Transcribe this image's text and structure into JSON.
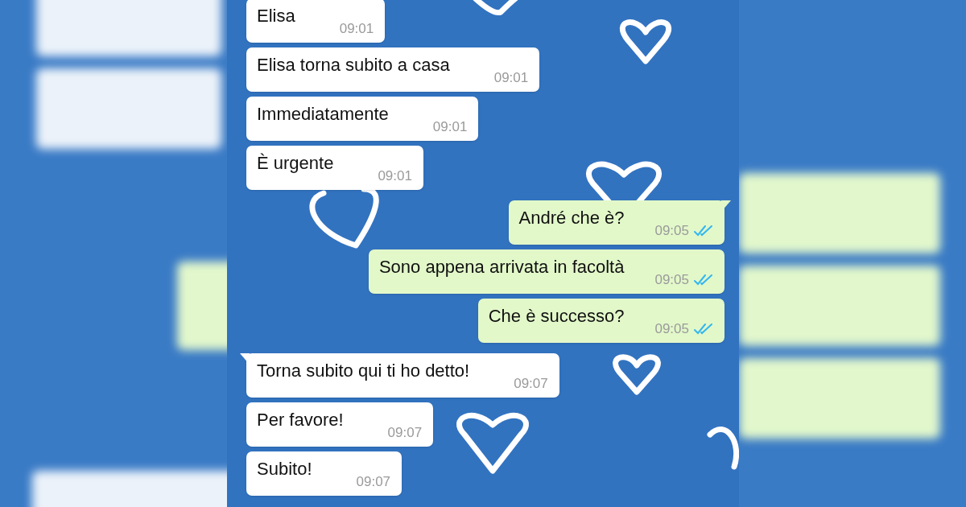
{
  "messages": [
    {
      "kind": "incoming",
      "tail": false,
      "text": "Elisa",
      "time": "09:01"
    },
    {
      "kind": "incoming",
      "tail": false,
      "text": "Elisa torna subito a casa",
      "time": "09:01"
    },
    {
      "kind": "incoming",
      "tail": false,
      "text": "Immediatamente",
      "time": "09:01"
    },
    {
      "kind": "incoming",
      "tail": false,
      "text": "È urgente",
      "time": "09:01"
    },
    {
      "kind": "outgoing",
      "tail": true,
      "text": "André che è?",
      "time": "09:05",
      "read": true
    },
    {
      "kind": "outgoing",
      "tail": false,
      "text": "Sono appena arrivata in facoltà",
      "time": "09:05",
      "read": true
    },
    {
      "kind": "outgoing",
      "tail": false,
      "text": "Che è successo?",
      "time": "09:05",
      "read": true
    },
    {
      "kind": "incoming",
      "tail": true,
      "text": "Torna subito qui ti ho detto!",
      "time": "09:07"
    },
    {
      "kind": "incoming",
      "tail": false,
      "text": "Per favore!",
      "time": "09:07"
    },
    {
      "kind": "incoming",
      "tail": false,
      "text": "Subito!",
      "time": "09:07"
    }
  ]
}
